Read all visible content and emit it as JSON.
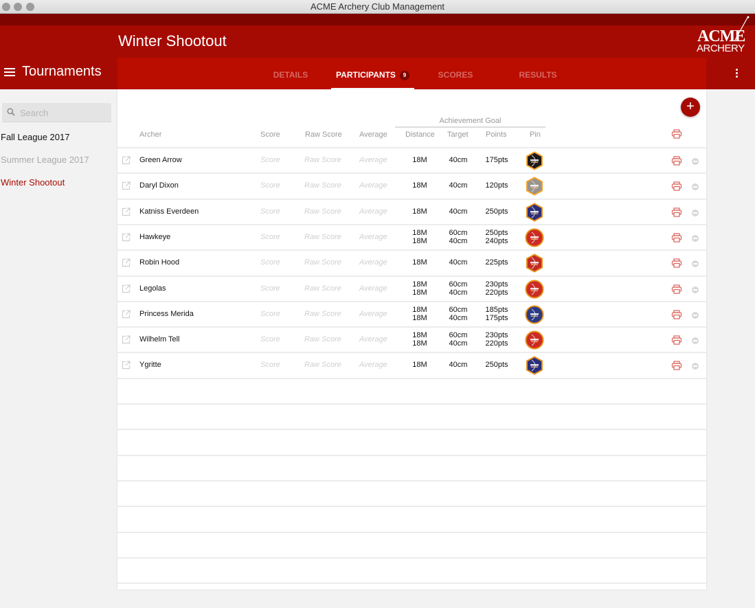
{
  "window": {
    "title": "ACME Archery Club Management"
  },
  "header": {
    "title": "Winter Shootout",
    "logo_line1": "ACME",
    "logo_line2": "ARCHERY"
  },
  "sidebar": {
    "title": "Tournaments",
    "search_placeholder": "Search",
    "items": [
      {
        "label": "Fall League 2017",
        "state": "normal",
        "color": "#111111"
      },
      {
        "label": "Summer League 2017",
        "state": "disabled",
        "color": "#a9a9a9"
      },
      {
        "label": "Winter Shootout",
        "state": "selected",
        "color": "#a60b03"
      }
    ]
  },
  "tabs": [
    {
      "label": "DETAILS",
      "active": false
    },
    {
      "label": "PARTICIPANTS",
      "active": true,
      "badge": "9"
    },
    {
      "label": "SCORES",
      "active": false
    },
    {
      "label": "RESULTS",
      "active": false
    }
  ],
  "table": {
    "group_header": "Achievement Goal",
    "columns": [
      "Archer",
      "Score",
      "Raw Score",
      "Average",
      "Distance",
      "Target",
      "Points",
      "Pin"
    ],
    "placeholders": {
      "score": "Score",
      "raw_score": "Raw Score",
      "average": "Average"
    },
    "rows": [
      {
        "archer": "Green Arrow",
        "goals": [
          {
            "distance": "18M",
            "target": "40cm",
            "points": "175pts"
          }
        ],
        "pin": {
          "shape": "hexagon",
          "fill": "#1f1a1a",
          "border": "#f1a42a"
        }
      },
      {
        "archer": "Daryl Dixon",
        "goals": [
          {
            "distance": "18M",
            "target": "40cm",
            "points": "120pts"
          }
        ],
        "pin": {
          "shape": "hexagon",
          "fill": "#9a928c",
          "border": "#f1a42a"
        }
      },
      {
        "archer": "Katniss Everdeen",
        "goals": [
          {
            "distance": "18M",
            "target": "40cm",
            "points": "250pts"
          }
        ],
        "pin": {
          "shape": "hexagon",
          "fill": "#2b2f7a",
          "border": "#e58f1c"
        }
      },
      {
        "archer": "Hawkeye",
        "goals": [
          {
            "distance": "18M",
            "target": "60cm",
            "points": "250pts"
          },
          {
            "distance": "18M",
            "target": "40cm",
            "points": "240pts"
          }
        ],
        "pin": {
          "shape": "circle",
          "fill": "#cc2a22",
          "border": "#e58f1c"
        }
      },
      {
        "archer": "Robin Hood",
        "goals": [
          {
            "distance": "18M",
            "target": "40cm",
            "points": "225pts"
          }
        ],
        "pin": {
          "shape": "hexagon",
          "fill": "#c22a22",
          "border": "#e58f1c"
        }
      },
      {
        "archer": "Legolas",
        "goals": [
          {
            "distance": "18M",
            "target": "60cm",
            "points": "230pts"
          },
          {
            "distance": "18M",
            "target": "40cm",
            "points": "220pts"
          }
        ],
        "pin": {
          "shape": "circle",
          "fill": "#cc2a22",
          "border": "#e58f1c"
        }
      },
      {
        "archer": "Princess Merida",
        "goals": [
          {
            "distance": "18M",
            "target": "60cm",
            "points": "185pts"
          },
          {
            "distance": "18M",
            "target": "40cm",
            "points": "175pts"
          }
        ],
        "pin": {
          "shape": "circle",
          "fill": "#2b3a84",
          "border": "#e58f1c"
        }
      },
      {
        "archer": "Wilhelm Tell",
        "goals": [
          {
            "distance": "18M",
            "target": "60cm",
            "points": "230pts"
          },
          {
            "distance": "18M",
            "target": "40cm",
            "points": "220pts"
          }
        ],
        "pin": {
          "shape": "circle",
          "fill": "#cc2a22",
          "border": "#e58f1c"
        }
      },
      {
        "archer": "Ygritte",
        "goals": [
          {
            "distance": "18M",
            "target": "40cm",
            "points": "250pts"
          }
        ],
        "pin": {
          "shape": "hexagon",
          "fill": "#2b2f7a",
          "border": "#e58f1c"
        }
      }
    ]
  },
  "colors": {
    "primary": "#a60b03",
    "tabbar": "#bb0c00",
    "dark_strip": "#7e0400",
    "print_icon": "#d9625a"
  }
}
